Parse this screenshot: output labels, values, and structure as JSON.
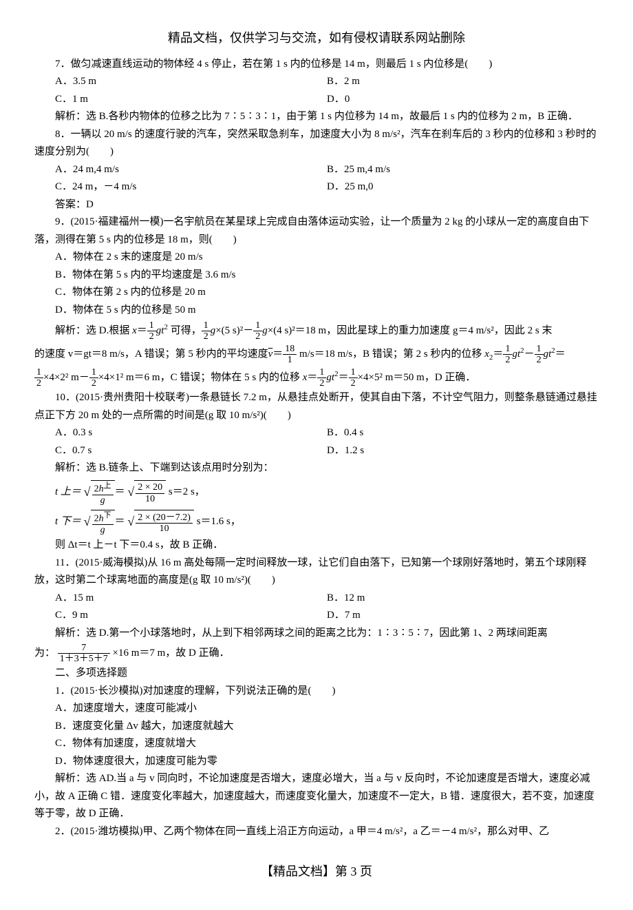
{
  "header": "精品文档，仅供学习与交流，如有侵权请联系网站删除",
  "q7": {
    "text": "7．做匀减速直线运动的物体经 4 s 停止，若在第 1 s 内的位移是 14 m，则最后 1 s 内位移是(　　)",
    "optA": "A．3.5 m",
    "optB": "B．2 m",
    "optC": "C．1 m",
    "optD": "D．0",
    "sol": "解析：选 B.各秒内物体的位移之比为 7∶5∶3∶1，由于第 1 s 内位移为 14 m，故最后 1 s 内的位移为 2 m，B 正确．"
  },
  "q8": {
    "text": "8．一辆以 20 m/s 的速度行驶的汽车，突然采取急刹车，加速度大小为 8 m/s²，汽车在刹车后的 3 秒内的位移和 3 秒时的速度分别为(　　)",
    "optA": "A．24 m,4 m/s",
    "optB": "B．25 m,4 m/s",
    "optC": "C．24 m，－4 m/s",
    "optD": "D．25 m,0",
    "ans": "答案：D"
  },
  "q9": {
    "text": "9．(2015·福建福州一模)一名宇航员在某星球上完成自由落体运动实验，让一个质量为 2 kg 的小球从一定的高度自由下落，测得在第 5 s 内的位移是 18 m，则(　　)",
    "optA": "A．物体在 2 s 末的速度是 20 m/s",
    "optB": "B．物体在第 5 s 内的平均速度是 3.6 m/s",
    "optC": "C．物体在第 2 s 内的位移是 20 m",
    "optD": "D．物体在 5 s 内的位移是 50 m",
    "sol_pre": "解析：选 D.根据 ",
    "sol_1": " 可得，",
    "sol_2": "×(5 s)²－",
    "sol_3": "×(4 s)²＝18 m，因此星球上的重力加速度 g＝4 m/s²，因此 2 s 末",
    "sol_line2a": "的速度 v＝gt＝8 m/s，A 错误；第 5 秒内的平均速度",
    "sol_line2b": " m/s＝18 m/s，B 错误；第 2 s 秒内的位移 ",
    "sol_line3": "×4×2² m－",
    "sol_line3b": "×4×1² m＝6 m，C 错误；物体在 5 s 内的位移 ",
    "sol_line3c": "×4×5² m＝50 m，D 正确．"
  },
  "q10": {
    "text": "10．(2015·贵州贵阳十校联考)一条悬链长 7.2 m，从悬挂点处断开，使其自由下落，不计空气阻力，则整条悬链通过悬挂点正下方 20 m 处的一点所需的时间是(g 取 10 m/s²)(　　)",
    "optA": "A．0.3 s",
    "optB": "B．0.4 s",
    "optC": "C．0.7 s",
    "optD": "D．1.2 s",
    "sol": "解析：选 B.链条上、下端到达该点用时分别为：",
    "eq1_lhs": "t 上＝",
    "eq1_r1": " s＝2 s，",
    "eq2_lhs": "t 下＝",
    "eq2_r1": " s＝1.6 s，",
    "sol_end": "则 Δt＝t 上－t 下＝0.4 s，故 B 正确．"
  },
  "q11": {
    "text": "11．(2015·威海模拟)从 16 m 高处每隔一定时间释放一球，让它们自由落下，已知第一个球刚好落地时，第五个球刚释放，这时第二个球离地面的高度是(g 取 10 m/s²)(　　)",
    "optA": "A．15 m",
    "optB": "B．12 m",
    "optC": "C．9 m",
    "optD": "D．7 m",
    "sol_pre": "解析：选 D.第一个小球落地时，从上到下相邻两球之间的距离之比为：1∶3∶5∶7，因此第 1、2 两球间距离",
    "sol_mid": "为：",
    "sol_end": "×16 m＝7 m，故 D 正确．"
  },
  "section2": "二、多项选择题",
  "mq1": {
    "text": "1．(2015·长沙模拟)对加速度的理解，下列说法正确的是(　　)",
    "optA": "A．加速度增大，速度可能减小",
    "optB": "B．速度变化量 Δv 越大，加速度就越大",
    "optC": "C．物体有加速度，速度就增大",
    "optD": "D．物体速度很大，加速度可能为零",
    "sol": "解析：选 AD.当 a 与 v 同向时，不论加速度是否增大，速度必增大，当 a 与 v 反向时，不论加速度是否增大，速度必减小，故 A 正确 C 错．速度变化率越大，加速度越大，而速度变化量大，加速度不一定大，B 错．速度很大，若不变，加速度等于零，故 D 正确．"
  },
  "mq2": {
    "text": "2．(2015·潍坊模拟)甲、乙两个物体在同一直线上沿正方向运动，a 甲＝4 m/s²，a 乙＝－4 m/s²，那么对甲、乙"
  },
  "footer": "【精品文档】第 3 页"
}
